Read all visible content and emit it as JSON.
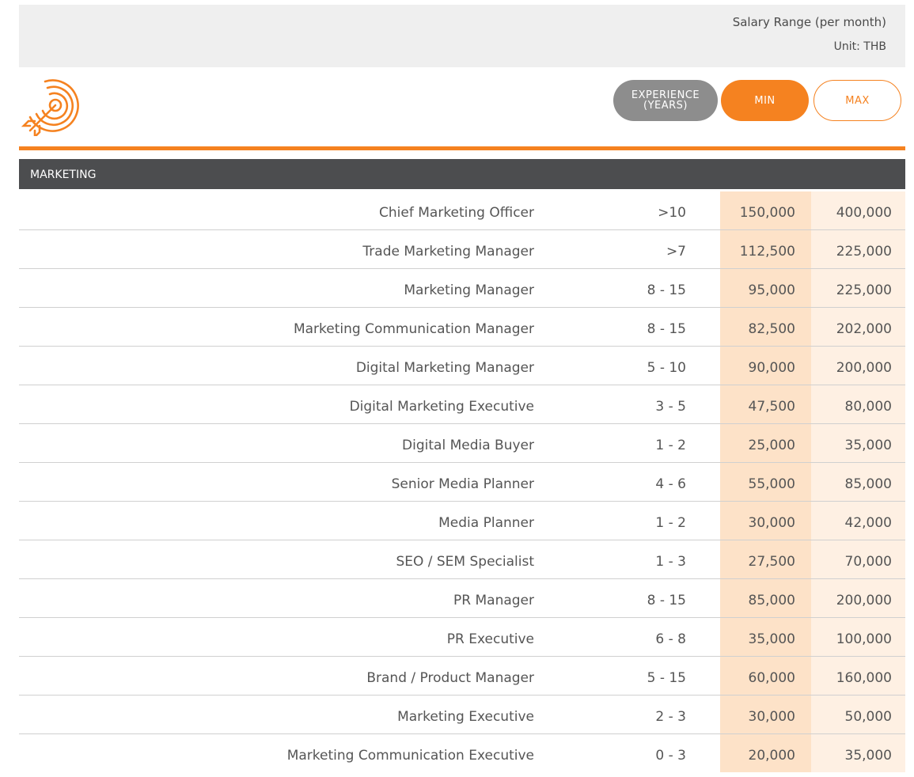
{
  "header": {
    "salary_range_label": "Salary Range  (per month)",
    "unit_label": "Unit: THB",
    "icon": "target-arrow-icon"
  },
  "legend": {
    "experience_line1": "EXPERIENCE",
    "experience_line2": "(YEARS)",
    "min_label": "MIN",
    "max_label": "MAX"
  },
  "colors": {
    "accent": "#f58220",
    "section_bar": "#4c4d4f",
    "experience_pill": "#8d8d8d",
    "min_column": "#fde2c8",
    "max_column": "#fef0e3"
  },
  "section": {
    "title": "MARKETING",
    "rows": [
      {
        "title": "Chief Marketing Officer",
        "experience": ">10",
        "min": "150,000",
        "max": "400,000"
      },
      {
        "title": "Trade Marketing Manager",
        "experience": ">7",
        "min": "112,500",
        "max": "225,000"
      },
      {
        "title": "Marketing Manager",
        "experience": "8 - 15",
        "min": "95,000",
        "max": "225,000"
      },
      {
        "title": "Marketing Communication Manager",
        "experience": "8 - 15",
        "min": "82,500",
        "max": "202,000"
      },
      {
        "title": "Digital Marketing Manager",
        "experience": "5 - 10",
        "min": "90,000",
        "max": "200,000"
      },
      {
        "title": "Digital Marketing Executive",
        "experience": "3 - 5",
        "min": "47,500",
        "max": "80,000"
      },
      {
        "title": "Digital Media Buyer",
        "experience": "1 - 2",
        "min": "25,000",
        "max": "35,000"
      },
      {
        "title": "Senior Media Planner",
        "experience": "4 - 6",
        "min": "55,000",
        "max": "85,000"
      },
      {
        "title": "Media Planner",
        "experience": "1 - 2",
        "min": "30,000",
        "max": "42,000"
      },
      {
        "title": "SEO / SEM Specialist",
        "experience": "1 - 3",
        "min": "27,500",
        "max": "70,000"
      },
      {
        "title": "PR Manager",
        "experience": "8 - 15",
        "min": "85,000",
        "max": "200,000"
      },
      {
        "title": "PR Executive",
        "experience": "6 - 8",
        "min": "35,000",
        "max": "100,000"
      },
      {
        "title": "Brand / Product Manager",
        "experience": "5 - 15",
        "min": "60,000",
        "max": "160,000"
      },
      {
        "title": "Marketing Executive",
        "experience": "2 - 3",
        "min": "30,000",
        "max": "50,000"
      },
      {
        "title": "Marketing Communication Executive",
        "experience": "0 - 3",
        "min": "20,000",
        "max": "35,000"
      }
    ]
  }
}
